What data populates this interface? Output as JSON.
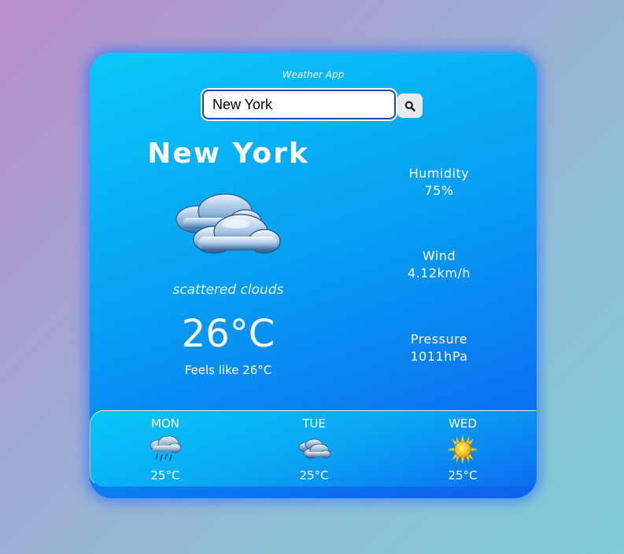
{
  "app": {
    "title": "Weather App"
  },
  "search": {
    "value": "New York",
    "button_icon": "search-icon"
  },
  "current": {
    "city": "New York",
    "icon": "scattered-clouds-icon",
    "description": "scattered clouds",
    "temperature": "26°C",
    "feels_like": "Feels like 26°C"
  },
  "stats": {
    "humidity": {
      "label": "Humidity",
      "value": "75%"
    },
    "wind": {
      "label": "Wind",
      "value": "4.12km/h"
    },
    "pressure": {
      "label": "Pressure",
      "value": "1011hPa"
    }
  },
  "forecast": [
    {
      "day": "MON",
      "icon": "rain-icon",
      "temp": "25°C"
    },
    {
      "day": "TUE",
      "icon": "clouds-icon",
      "temp": "25°C"
    },
    {
      "day": "WED",
      "icon": "sun-icon",
      "temp": "25°C"
    }
  ],
  "colors": {
    "card_top": "#0bc8f8",
    "card_bottom": "#0d5fee",
    "glow": "#286eff",
    "text": "#ffffff"
  }
}
